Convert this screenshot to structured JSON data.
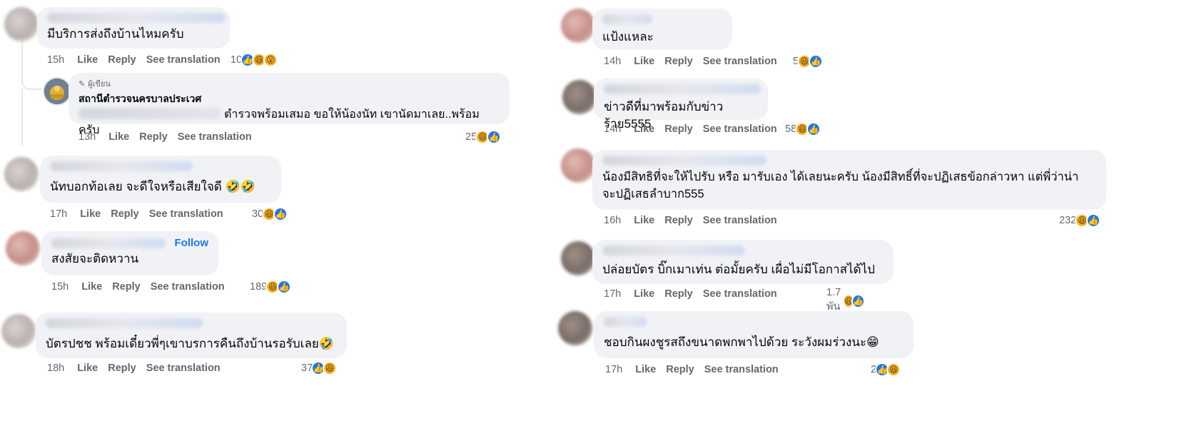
{
  "left_comments": [
    {
      "text": "มีบริการส่งถึงบ้านไหมครับ",
      "time": "15h",
      "like": "Like",
      "reply": "Reply",
      "see_translation": "See translation",
      "count": "10",
      "reactions": [
        "like-icon",
        "haha-icon",
        "wow-icon"
      ]
    },
    {
      "author_tag": "ผู้เขียน",
      "author_name": "สถานีตำรวจนครบาลประเวศ",
      "text": "ตำรวจพร้อมเสมอ ขอให้น้องนัท เขานัดมาเลย..พร้อมครับ",
      "time": "13h",
      "like": "Like",
      "reply": "Reply",
      "see_translation": "See translation",
      "count": "25",
      "reactions": [
        "haha-icon",
        "like-icon"
      ]
    },
    {
      "text": "นัทบอกท้อเลย จะดีใจหรือเสียใจดี 🤣🤣",
      "time": "17h",
      "like": "Like",
      "reply": "Reply",
      "see_translation": "See translation",
      "count": "30",
      "reactions": [
        "haha-icon",
        "like-icon"
      ]
    },
    {
      "follow": "Follow",
      "text": "สงสัยจะติดหวาน",
      "time": "15h",
      "like": "Like",
      "reply": "Reply",
      "see_translation": "See translation",
      "count": "189",
      "reactions": [
        "haha-icon",
        "like-icon"
      ]
    },
    {
      "text": "บัตรปชช พร้อมเดี๋ยวพี่ๆเขาบรการคืนถึงบ้านรอรับเลย🤣",
      "time": "18h",
      "like": "Like",
      "reply": "Reply",
      "see_translation": "See translation",
      "count": "37",
      "reactions": [
        "like-icon",
        "haha-icon"
      ]
    }
  ],
  "right_comments": [
    {
      "text": "แป้งแหละ",
      "time": "14h",
      "like": "Like",
      "reply": "Reply",
      "see_translation": "See translation",
      "count": "5",
      "reactions": [
        "haha-icon",
        "like-icon"
      ]
    },
    {
      "text": "ข่าวดีที่มาพร้อมกับข่าวร้าย5555",
      "time": "14h",
      "like": "Like",
      "reply": "Reply",
      "see_translation": "See translation",
      "count": "58",
      "reactions": [
        "haha-icon",
        "like-icon"
      ]
    },
    {
      "text_line1": "น้องมีสิทธิที่จะให้ไปรับ หรือ มารับเอง ได้เลยนะครับ น้องมีสิทธิ์ที่จะปฏิเสธข้อกล่าวหา แต่พี่ว่าน่า",
      "text_line2": "จะปฏิเสธลำบาก555",
      "time": "16h",
      "like": "Like",
      "reply": "Reply",
      "see_translation": "See translation",
      "count": "232",
      "reactions": [
        "haha-icon",
        "like-icon"
      ]
    },
    {
      "text": "ปล่อยบัตร บิ๊กเมาเท่น ต่อมั้ยครับ เผื่อไม่มีโอกาสได้ไป",
      "time": "17h",
      "like": "Like",
      "reply": "Reply",
      "see_translation": "See translation",
      "count": "1.7 พัน",
      "reactions": [
        "haha-icon",
        "like-icon"
      ]
    },
    {
      "text": "ชอบกินผงชูรสถึงขนาดพกพาไปด้วย ระวังผมร่วงนะ😁",
      "time": "17h",
      "like": "Like",
      "reply": "Reply",
      "see_translation": "See translation",
      "count": "2",
      "reactions": [
        "like-icon",
        "haha-icon"
      ]
    }
  ],
  "colors": {
    "bubble": "#f0f2f5",
    "meta": "#65676b",
    "like_blue": "#1877f2",
    "haha_yellow": "#f7b125",
    "follow_blue": "#1877f2"
  }
}
